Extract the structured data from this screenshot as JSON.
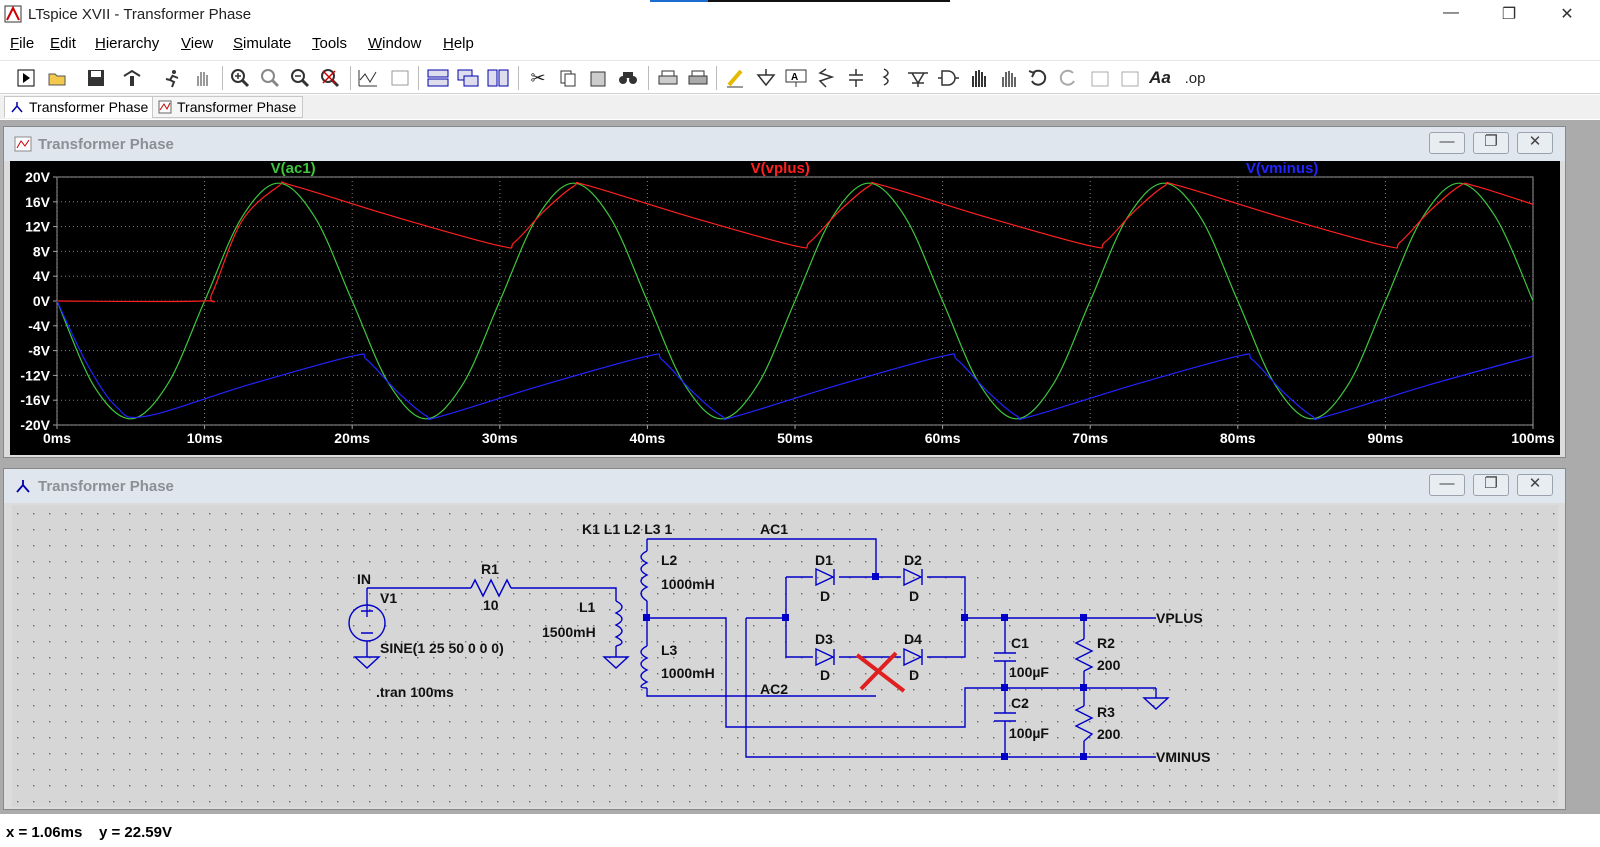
{
  "window": {
    "title": "LTspice XVII - Transformer Phase",
    "controls": [
      "—",
      "❐",
      "✕"
    ]
  },
  "menu": [
    {
      "label": "File",
      "key": "F"
    },
    {
      "label": "Edit",
      "key": "E"
    },
    {
      "label": "Hierarchy",
      "key": "H"
    },
    {
      "label": "View",
      "key": "V"
    },
    {
      "label": "Simulate",
      "key": "S"
    },
    {
      "label": "Tools",
      "key": "T"
    },
    {
      "label": "Window",
      "key": "W"
    },
    {
      "label": "Help",
      "key": "H"
    }
  ],
  "toolbar": {
    "icons": [
      "run-icon",
      "open-icon",
      "save-icon",
      "control-panel-icon",
      "run-simulation-icon",
      "pan-icon",
      "zoom-in-icon",
      "zoom-area-icon",
      "zoom-out-icon",
      "zoom-fit-icon",
      "autorange-icon",
      "mark-unref-icon",
      "tile-horizontal-icon",
      "cascade-icon",
      "tile-vertical-icon",
      "cut-icon",
      "copy-icon",
      "paste-icon",
      "find-icon",
      "print-icon",
      "print-setup-icon",
      "draw-wire-icon",
      "ground-icon",
      "label-net-icon",
      "resistor-icon",
      "capacitor-icon",
      "inductor-icon",
      "diode-icon",
      "component-icon",
      "move-icon",
      "drag-icon",
      "undo-icon",
      "redo-icon",
      "rotate-icon",
      "mirror-icon",
      "text-icon",
      "spice-directive-icon"
    ],
    "text_label": "Aa",
    "op_label": ".op"
  },
  "tabs": [
    {
      "label": "Transformer Phase",
      "active": true
    },
    {
      "label": "Transformer Phase",
      "active": false
    }
  ],
  "plot_pane": {
    "title": "Transformer Phase",
    "buttons": [
      "—",
      "❐",
      "✕"
    ]
  },
  "schematic_pane": {
    "title": "Transformer Phase",
    "buttons": [
      "—",
      "❐",
      "✕"
    ]
  },
  "chart_data": {
    "type": "line",
    "background": "#000000",
    "xlim": [
      0,
      100
    ],
    "ylim": [
      -20,
      20
    ],
    "x_ticks": [
      "0ms",
      "10ms",
      "20ms",
      "30ms",
      "40ms",
      "50ms",
      "60ms",
      "70ms",
      "80ms",
      "90ms",
      "100ms"
    ],
    "y_ticks": [
      "20V",
      "16V",
      "12V",
      "8V",
      "4V",
      "0V",
      "-4V",
      "-8V",
      "-12V",
      "-16V",
      "-20V"
    ],
    "grid": true,
    "series": [
      {
        "name": "V(ac1)",
        "color": "#3ec63e",
        "x": [
          0,
          2.5,
          5,
          7.5,
          10,
          12.5,
          15,
          17.5,
          20,
          22.5,
          25,
          27.5,
          30,
          32.5,
          35,
          37.5,
          40,
          42.5,
          45,
          47.5,
          50,
          52.5,
          55,
          57.5,
          60,
          62.5,
          65,
          67.5,
          70,
          72.5,
          75,
          77.5,
          80,
          82.5,
          85,
          87.5,
          90,
          92.5,
          95,
          97.5,
          100
        ],
        "y": [
          0,
          -13.7,
          -19,
          -13.4,
          0,
          13.4,
          19,
          13.4,
          0,
          -13.4,
          -19,
          -13.4,
          0,
          13.4,
          19,
          13.4,
          0,
          -13.4,
          -19,
          -13.4,
          0,
          13.4,
          19,
          13.4,
          0,
          -13.4,
          -19,
          -13.4,
          0,
          13.4,
          19,
          13.4,
          0,
          -13.4,
          -19,
          -13.4,
          0,
          13.4,
          19,
          13.4,
          0
        ]
      },
      {
        "name": "V(vplus)",
        "color": "#ff2020",
        "x": [
          0,
          9.8,
          10.5,
          12.5,
          15,
          16,
          23,
          30,
          31,
          33,
          35,
          36,
          43,
          50,
          51,
          53,
          55,
          56,
          63,
          70,
          71,
          73,
          75,
          76,
          83,
          90,
          91,
          93,
          95,
          96,
          100
        ],
        "y": [
          0,
          0,
          1.2,
          12.8,
          18.5,
          18.6,
          13.5,
          8.9,
          9.5,
          14.5,
          18.5,
          18.6,
          13.5,
          8.9,
          9.5,
          14.5,
          18.5,
          18.6,
          13.5,
          8.9,
          9.5,
          14.5,
          18.5,
          18.6,
          13.5,
          8.9,
          9.5,
          14.5,
          18.5,
          18.6,
          15.6
        ]
      },
      {
        "name": "V(vminus)",
        "color": "#2323ff",
        "x": [
          0,
          2,
          4,
          6,
          13,
          20,
          21,
          23,
          25,
          26,
          33,
          40,
          41,
          43,
          45,
          46,
          53,
          60,
          61,
          63,
          65,
          66,
          73,
          80,
          81,
          83,
          85,
          86,
          93,
          100
        ],
        "y": [
          0,
          -10,
          -17,
          -18.6,
          -13.5,
          -8.9,
          -9.5,
          -14.5,
          -18.5,
          -18.6,
          -13.5,
          -8.9,
          -9.5,
          -14.5,
          -18.5,
          -18.6,
          -13.5,
          -8.9,
          -9.5,
          -14.5,
          -18.5,
          -18.6,
          -13.5,
          -8.9,
          -9.5,
          -14.5,
          -18.5,
          -18.6,
          -13.5,
          -8.9
        ]
      }
    ]
  },
  "schematic": {
    "coupling": "K1 L1 L2 L3 1",
    "net_in": "IN",
    "net_ac1": "AC1",
    "net_ac2": "AC2",
    "net_vplus": "VPLUS",
    "net_vminus": "VMINUS",
    "v1_name": "V1",
    "v1_value": "SINE(1 25 50 0 0 0)",
    "r1_name": "R1",
    "r1_value": "10",
    "l1_name": "L1",
    "l1_value": "1500mH",
    "l2_name": "L2",
    "l2_value": "1000mH",
    "l3_name": "L3",
    "l3_value": "1000mH",
    "d1_name": "D1",
    "d1_value": "D",
    "d2_name": "D2",
    "d2_value": "D",
    "d3_name": "D3",
    "d3_value": "D",
    "d4_name": "D4",
    "d4_value": "D",
    "c1_name": "C1",
    "c1_value": "100µF",
    "c2_name": "C2",
    "c2_value": "100µF",
    "r2_name": "R2",
    "r2_value": "200",
    "r3_name": "R3",
    "r3_value": "200",
    "directive": ".tran 100ms"
  },
  "status": "x = 1.06ms    y = 22.59V"
}
